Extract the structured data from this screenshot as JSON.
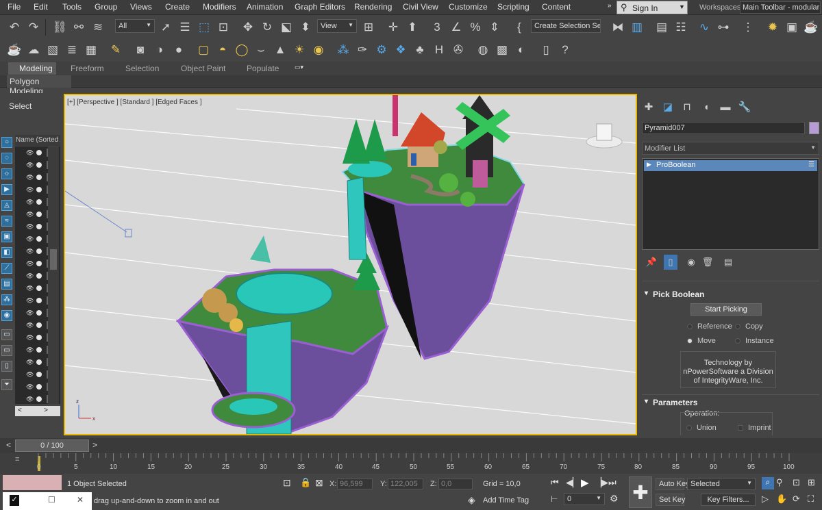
{
  "menu": [
    "File",
    "Edit",
    "Tools",
    "Group",
    "Views",
    "Create",
    "Modifiers",
    "Animation",
    "Graph Editors",
    "Rendering",
    "Civil View",
    "Customize",
    "Scripting",
    "Content"
  ],
  "signin": {
    "label": "Sign In"
  },
  "workspaces": {
    "label": "Workspaces:",
    "value": "Main Toolbar - modular"
  },
  "toolbar": {
    "filter": "All",
    "refcoord": "View",
    "selection_set": "Create Selection Se"
  },
  "ribbon": {
    "tabs": [
      "Modeling",
      "Freeform",
      "Selection",
      "Object Paint",
      "Populate"
    ],
    "sub": "Polygon Modeling"
  },
  "explorer": {
    "select_label": "Select",
    "header": "Name (Sorted Ascending)"
  },
  "viewport": {
    "label": "[+] [Perspective ] [Standard ] [Edged Faces ]"
  },
  "command_panel": {
    "object_name": "Pyramid007",
    "object_color": "#b79bd6",
    "modifier_list": "Modifier List",
    "stack_item": "ProBoolean",
    "pick_boolean": {
      "title": "Pick Boolean",
      "start_button": "Start Picking",
      "options": [
        "Reference",
        "Copy",
        "Move",
        "Instance"
      ],
      "selected": "Move",
      "tech_line1": "Technology by",
      "tech_line2": "nPowerSoftware a Division",
      "tech_line3": "of IntegrityWare, Inc."
    },
    "parameters": {
      "title": "Parameters",
      "operation_label": "Operation:",
      "options": [
        "Union",
        "Imprint"
      ]
    }
  },
  "timeline": {
    "frame": "0 / 100",
    "ticks": [
      "0",
      "5",
      "10",
      "15",
      "20",
      "25",
      "30",
      "35",
      "40",
      "45",
      "50",
      "55",
      "60",
      "65",
      "70",
      "75",
      "80",
      "85",
      "90",
      "95",
      "100"
    ]
  },
  "status": {
    "selected": "1 Object Selected",
    "prompt": "drag up-and-down to zoom in and out",
    "x_label": "X:",
    "x": "96,599",
    "y_label": "Y:",
    "y": "122,005",
    "z_label": "Z:",
    "z": "0,0",
    "grid": "Grid = 10,0",
    "add_time_tag": "Add Time Tag",
    "auto_key": "Auto Key",
    "set_key": "Set Key",
    "key_mode": "Selected",
    "key_filters": "Key Filters...",
    "frame_field": "0"
  },
  "colors": {
    "accent": "#e8b700",
    "selection_blue": "#5c87ba"
  }
}
